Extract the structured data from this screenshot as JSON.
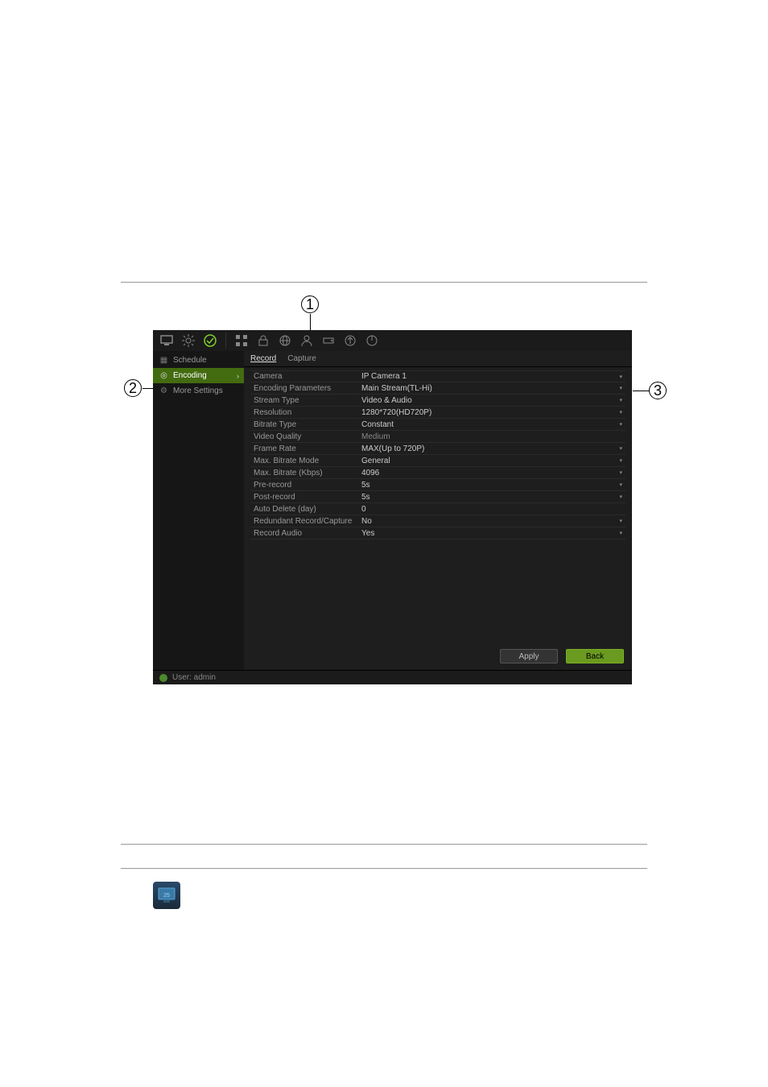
{
  "annotations": {
    "a1": "1",
    "a2": "2",
    "a3": "3"
  },
  "toolbar": {
    "icons": [
      "monitor-icon",
      "gear-icon",
      "check-icon",
      "grid-icon",
      "lock-icon",
      "globe-icon",
      "user-icon",
      "disk-icon",
      "upload-icon",
      "power-icon"
    ]
  },
  "sidebar": {
    "items": [
      {
        "icon": "calendar-icon",
        "label": "Schedule",
        "selected": false
      },
      {
        "icon": "circle-icon",
        "label": "Encoding",
        "selected": true
      },
      {
        "icon": "gear-icon",
        "label": "More Settings",
        "selected": false
      }
    ]
  },
  "tabs": [
    {
      "label": "Record",
      "active": true
    },
    {
      "label": "Capture",
      "active": false
    }
  ],
  "form": [
    {
      "label": "Camera",
      "value": "IP Camera 1",
      "dropdown": true
    },
    {
      "label": "Encoding Parameters",
      "value": "Main Stream(TL-Hi)",
      "dropdown": true
    },
    {
      "label": "Stream Type",
      "value": "Video & Audio",
      "dropdown": true
    },
    {
      "label": "Resolution",
      "value": "1280*720(HD720P)",
      "dropdown": true
    },
    {
      "label": "Bitrate Type",
      "value": "Constant",
      "dropdown": true
    },
    {
      "label": "Video Quality",
      "value": "Medium",
      "dropdown": false,
      "readonly": true
    },
    {
      "label": "Frame Rate",
      "value": "MAX(Up to 720P)",
      "dropdown": true
    },
    {
      "label": "Max. Bitrate Mode",
      "value": "General",
      "dropdown": true
    },
    {
      "label": "Max. Bitrate (Kbps)",
      "value": "4096",
      "dropdown": true
    },
    {
      "label": "Pre-record",
      "value": "5s",
      "dropdown": true
    },
    {
      "label": "Post-record",
      "value": "5s",
      "dropdown": true
    },
    {
      "label": "Auto Delete (day)",
      "value": "0",
      "dropdown": false
    },
    {
      "label": "Redundant Record/Capture",
      "value": "No",
      "dropdown": true
    },
    {
      "label": "Record Audio",
      "value": "Yes",
      "dropdown": true
    }
  ],
  "buttons": {
    "apply": "Apply",
    "back": "Back"
  },
  "status": {
    "user_label": "User: admin"
  }
}
